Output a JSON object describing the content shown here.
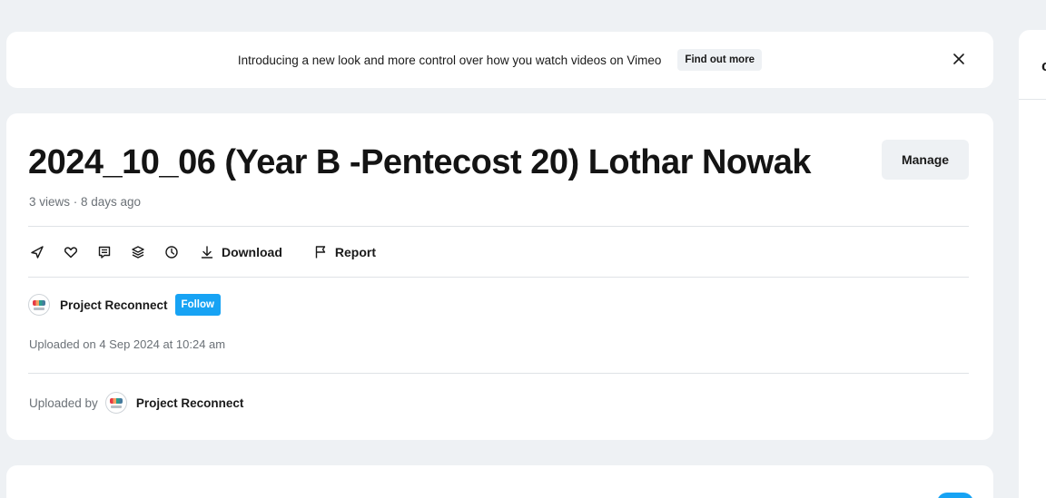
{
  "banner": {
    "text": "Introducing a new look and more control over how you watch videos on Vimeo",
    "button_label": "Find out more",
    "close_icon": "close-icon"
  },
  "video": {
    "title": "2024_10_06 (Year B -Pentecost 20) Lothar Nowak",
    "manage_label": "Manage",
    "meta": "3 views · 8 days ago"
  },
  "actions": {
    "icons": [
      "share-icon",
      "heart-icon",
      "comment-icon",
      "collections-icon",
      "watch-later-icon"
    ],
    "download_label": "Download",
    "report_label": "Report"
  },
  "channel": {
    "name": "Project Reconnect",
    "follow_label": "Follow",
    "uploaded_on": "Uploaded on 4 Sep 2024 at 10:24 am"
  },
  "uploaded_by": {
    "label": "Uploaded by",
    "name": "Project Reconnect"
  },
  "colors": {
    "accent": "#17a3f4",
    "page_bg": "#eef1f4",
    "card_bg": "#ffffff",
    "muted_text": "#6b7177"
  }
}
